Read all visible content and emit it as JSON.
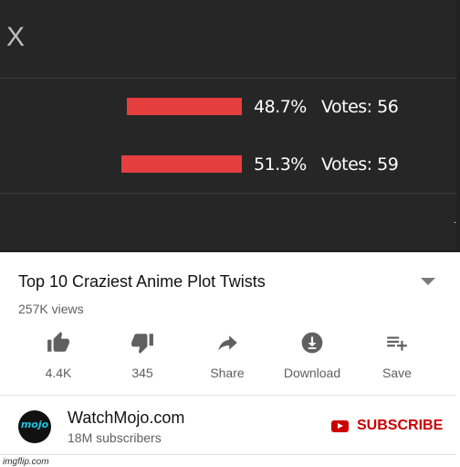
{
  "poll": {
    "close_label": "X",
    "options": [
      {
        "bar_fraction": 0.487,
        "percent": "48.7%",
        "votes": "Votes: 56"
      },
      {
        "bar_fraction": 0.513,
        "percent": "51.3%",
        "votes": "Votes: 59"
      }
    ],
    "trailing_dot": ".",
    "bar_color": "#e53e3e",
    "background_color": "#262626"
  },
  "video": {
    "title": "Top 10 Craziest Anime Plot Twists",
    "views": "257K views",
    "expand_icon": "chevron-down-icon"
  },
  "actions": [
    {
      "icon": "thumbs-up-icon",
      "label": "4.4K"
    },
    {
      "icon": "thumbs-down-icon",
      "label": "345"
    },
    {
      "icon": "share-icon",
      "label": "Share"
    },
    {
      "icon": "download-icon",
      "label": "Download"
    },
    {
      "icon": "playlist-add-icon",
      "label": "Save"
    }
  ],
  "channel": {
    "avatar_text": "mojo",
    "name": "WatchMojo.com",
    "subscribers": "18M subscribers",
    "subscribe_label": "SUBSCRIBE",
    "subscribe_color": "#cc0000"
  },
  "watermark": "imgflip.com"
}
